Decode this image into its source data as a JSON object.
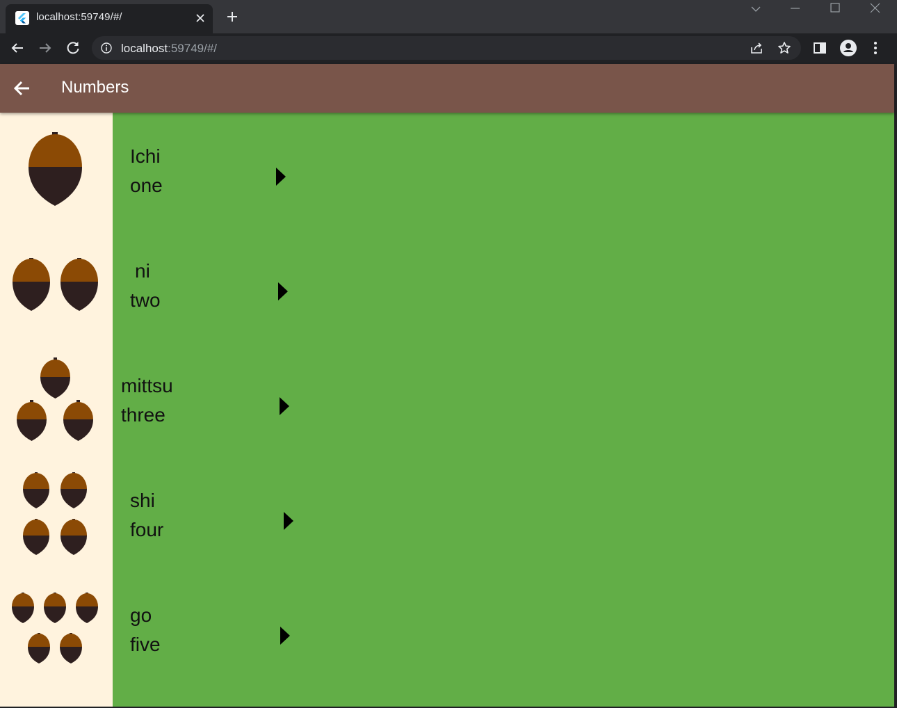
{
  "browser": {
    "tab_title": "localhost:59749/#/",
    "url_host": "localhost",
    "url_rest": ":59749/#/"
  },
  "app": {
    "title": "Numbers",
    "colors": {
      "appbar": "#79554a",
      "body": "#62ae47",
      "sidebar": "#fff3de",
      "acorn_cap": "#8b4a05",
      "acorn_body": "#2e1f1f"
    }
  },
  "numbers": [
    {
      "japanese": "Ichi",
      "english": "one",
      "count": 1
    },
    {
      "japanese": "ni",
      "english": "two",
      "count": 2
    },
    {
      "japanese": "mittsu",
      "english": "three",
      "count": 3
    },
    {
      "japanese": "shi",
      "english": "four",
      "count": 4
    },
    {
      "japanese": "go",
      "english": "five",
      "count": 5
    }
  ]
}
